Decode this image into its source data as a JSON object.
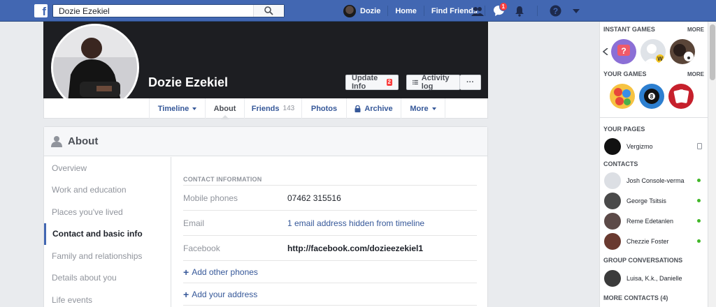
{
  "topbar": {
    "search_value": "Dozie Ezekiel",
    "user_name": "Dozie",
    "home": "Home",
    "find_friends": "Find Friends",
    "messages_badge": "1"
  },
  "profile": {
    "name": "Dozie Ezekiel",
    "update_info": "Update Info",
    "update_badge": "2",
    "activity_log": "Activity log",
    "more_dots": "···"
  },
  "tabs": [
    {
      "label": "Timeline"
    },
    {
      "label": "About"
    },
    {
      "label": "Friends",
      "count": "143"
    },
    {
      "label": "Photos"
    },
    {
      "label": "Archive"
    },
    {
      "label": "More"
    }
  ],
  "about": {
    "title": "About",
    "sidebar": [
      "Overview",
      "Work and education",
      "Places you've lived",
      "Contact and basic info",
      "Family and relationships",
      "Details about you",
      "Life events"
    ],
    "section_title": "CONTACT INFORMATION",
    "rows": [
      {
        "label": "Mobile phones",
        "value": "07462 315516"
      },
      {
        "label": "Email",
        "value": "1 email address hidden from timeline"
      },
      {
        "label": "Facebook",
        "value": "http://facebook.com/dozieezekiel1"
      }
    ],
    "add_phones": "Add other phones",
    "add_address": "Add your address"
  },
  "rail": {
    "instant_games": "INSTANT GAMES",
    "more1": "MORE",
    "your_games": "YOUR GAMES",
    "more2": "MORE",
    "your_pages": "YOUR PAGES",
    "page_name": "Vergizmo",
    "contacts": "CONTACTS",
    "contact_list": [
      "Josh Console-verma",
      "George Tsitsis",
      "Reme Edetanlen",
      "Chezzie Foster"
    ],
    "group_conversations": "GROUP CONVERSATIONS",
    "group_name": "Luisa, K.k., Danielle",
    "more_contacts": "MORE CONTACTS (4)"
  },
  "colors": {
    "brand": "#4267b2",
    "link": "#365899",
    "online": "#42b72a"
  }
}
